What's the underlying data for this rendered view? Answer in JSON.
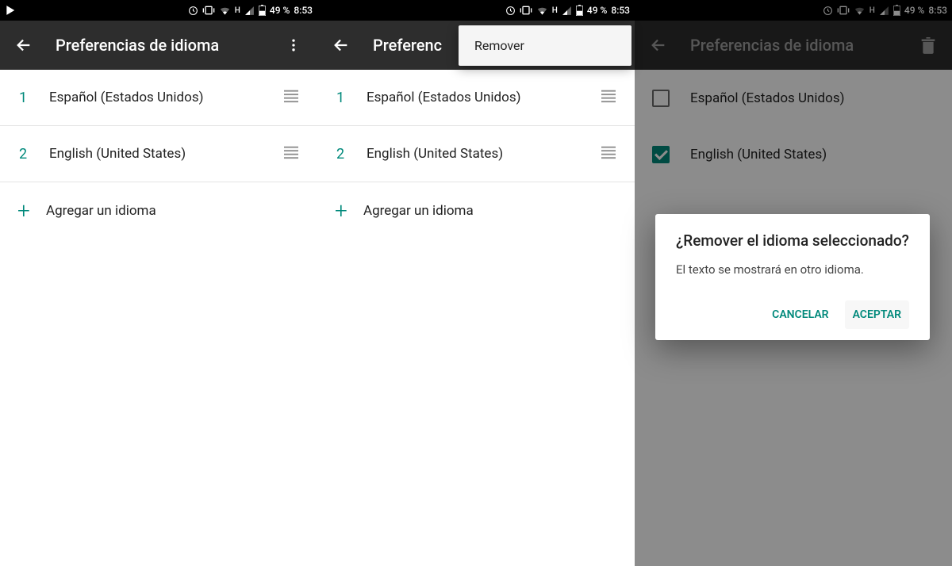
{
  "status": {
    "battery": "49 %",
    "time": "8:53",
    "net": "H"
  },
  "appbar": {
    "title": "Preferencias de idioma"
  },
  "languages": [
    {
      "num": "1",
      "name": "Español (Estados Unidos)"
    },
    {
      "num": "2",
      "name": "English (United States)"
    }
  ],
  "add_label": "Agregar un idioma",
  "popup": {
    "remove": "Remover"
  },
  "screen3": {
    "items": [
      {
        "checked": false,
        "name": "Español (Estados Unidos)"
      },
      {
        "checked": true,
        "name": "English (United States)"
      }
    ]
  },
  "dialog": {
    "title": "¿Remover el idioma seleccionado?",
    "body": "El texto se mostrará en otro idioma.",
    "cancel": "CANCELAR",
    "accept": "ACEPTAR"
  }
}
